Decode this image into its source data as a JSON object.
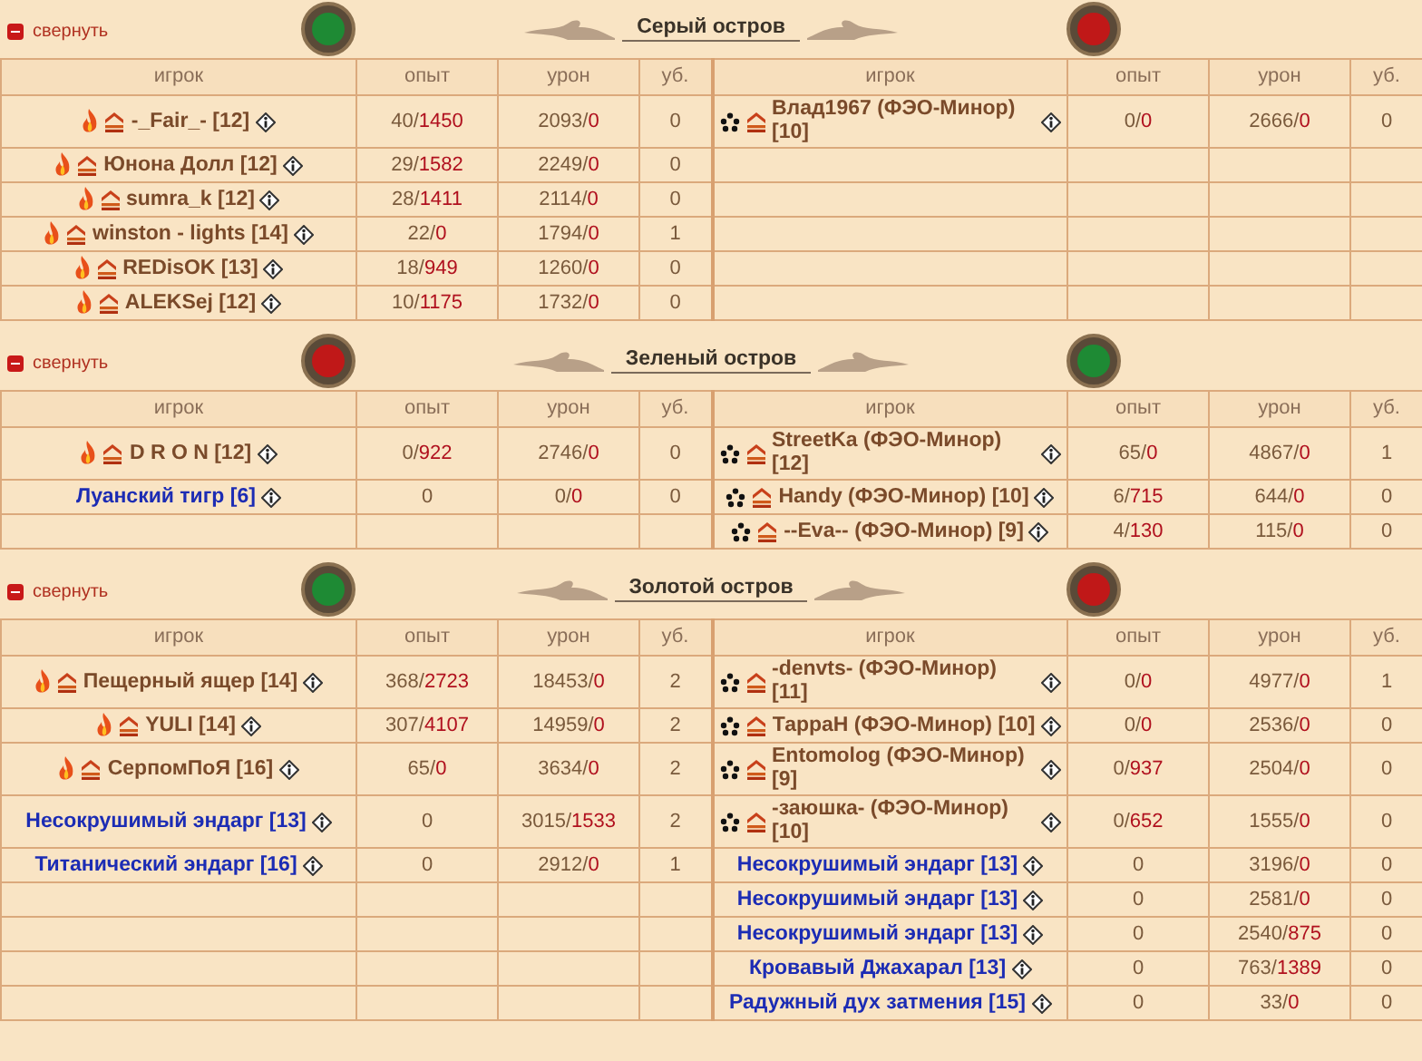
{
  "sections": [
    {
      "collapse_link": "свернуть",
      "title": "Серый остров",
      "flags": [
        {
          "color": "#1e8a34"
        },
        {
          "color": "#c01818"
        }
      ],
      "columns": [
        "игрок",
        "опыт",
        "урон",
        "уб.",
        "игрок",
        "опыт",
        "урон",
        "уб."
      ],
      "left": [
        {
          "kind": "fire",
          "name": "-_Fair_- [12]",
          "exp": "40/1450",
          "damage": "2093/0",
          "kills": "0"
        },
        {
          "kind": "fire",
          "name": "Юнона Долл [12]",
          "exp": "29/1582",
          "damage": "2249/0",
          "kills": "0"
        },
        {
          "kind": "fire",
          "name": "sumra_k [12]",
          "exp": "28/1411",
          "damage": "2114/0",
          "kills": "0"
        },
        {
          "kind": "fire",
          "name": "winston - lights [14]",
          "exp": "22/0",
          "damage": "1794/0",
          "kills": "1"
        },
        {
          "kind": "fire",
          "name": "REDisOK [13]",
          "exp": "18/949",
          "damage": "1260/0",
          "kills": "0"
        },
        {
          "kind": "fire",
          "name": "ALEKSej [12]",
          "exp": "10/1175",
          "damage": "1732/0",
          "kills": "0"
        }
      ],
      "right": [
        {
          "kind": "stars",
          "name": "Влад1967 (ФЭО-Минор) [10]",
          "exp": "0/0",
          "damage": "2666/0",
          "kills": "0"
        }
      ]
    },
    {
      "collapse_link": "свернуть",
      "title": "Зеленый остров",
      "flags": [
        {
          "color": "#c01818"
        },
        {
          "color": "#1e8a34"
        }
      ],
      "columns": [
        "игрок",
        "опыт",
        "урон",
        "уб.",
        "игрок",
        "опыт",
        "урон",
        "уб."
      ],
      "left": [
        {
          "kind": "fire",
          "name": "D R O N [12]",
          "exp": "0/922",
          "damage": "2746/0",
          "kills": "0"
        },
        {
          "kind": "mob",
          "name": "Луанский тигр [6]",
          "exp": "0",
          "damage": "0/0",
          "kills": "0"
        }
      ],
      "right": [
        {
          "kind": "stars",
          "name": "StreetKa (ФЭО-Минор) [12]",
          "exp": "65/0",
          "damage": "4867/0",
          "kills": "1"
        },
        {
          "kind": "stars",
          "name": "Handy (ФЭО-Минор) [10]",
          "exp": "6/715",
          "damage": "644/0",
          "kills": "0"
        },
        {
          "kind": "stars",
          "name": "--Eva-- (ФЭО-Минор) [9]",
          "exp": "4/130",
          "damage": "115/0",
          "kills": "0"
        }
      ]
    },
    {
      "collapse_link": "свернуть",
      "title": "Золотой остров",
      "flags": [
        {
          "color": "#1e8a34"
        },
        {
          "color": "#c01818"
        }
      ],
      "columns": [
        "игрок",
        "опыт",
        "урон",
        "уб.",
        "игрок",
        "опыт",
        "урон",
        "уб."
      ],
      "left": [
        {
          "kind": "fire",
          "name": "Пещерный ящер [14]",
          "exp": "368/2723",
          "damage": "18453/0",
          "kills": "2"
        },
        {
          "kind": "fire",
          "name": "YULI [14]",
          "exp": "307/4107",
          "damage": "14959/0",
          "kills": "2"
        },
        {
          "kind": "fire",
          "name": "СерпомПоЯ [16]",
          "exp": "65/0",
          "damage": "3634/0",
          "kills": "2"
        },
        {
          "kind": "mob",
          "name": "Несокрушимый эндарг [13]",
          "exp": "0",
          "damage": "3015/1533",
          "kills": "2"
        },
        {
          "kind": "mob",
          "name": "Титанический эндарг [16]",
          "exp": "0",
          "damage": "2912/0",
          "kills": "1"
        }
      ],
      "right": [
        {
          "kind": "stars",
          "name": "-denvts- (ФЭО-Минор) [11]",
          "exp": "0/0",
          "damage": "4977/0",
          "kills": "1"
        },
        {
          "kind": "stars",
          "name": "ТаррaН (ФЭО-Минор) [10]",
          "exp": "0/0",
          "damage": "2536/0",
          "kills": "0"
        },
        {
          "kind": "stars",
          "name": "Entomolog (ФЭО-Минор) [9]",
          "exp": "0/937",
          "damage": "2504/0",
          "kills": "0"
        },
        {
          "kind": "stars",
          "name": "-заюшка- (ФЭО-Минор) [10]",
          "exp": "0/652",
          "damage": "1555/0",
          "kills": "0"
        },
        {
          "kind": "mob",
          "name": "Несокрушимый эндарг [13]",
          "exp": "0",
          "damage": "3196/0",
          "kills": "0"
        },
        {
          "kind": "mob",
          "name": "Несокрушимый эндарг [13]",
          "exp": "0",
          "damage": "2581/0",
          "kills": "0"
        },
        {
          "kind": "mob",
          "name": "Несокрушимый эндарг [13]",
          "exp": "0",
          "damage": "2540/875",
          "kills": "0"
        },
        {
          "kind": "mob",
          "name": "Кровавый Джахарал [13]",
          "exp": "0",
          "damage": "763/1389",
          "kills": "0"
        },
        {
          "kind": "mob",
          "name": "Радужный дух затмения  [15]",
          "exp": "0",
          "damage": "33/0",
          "kills": "0"
        }
      ]
    }
  ]
}
